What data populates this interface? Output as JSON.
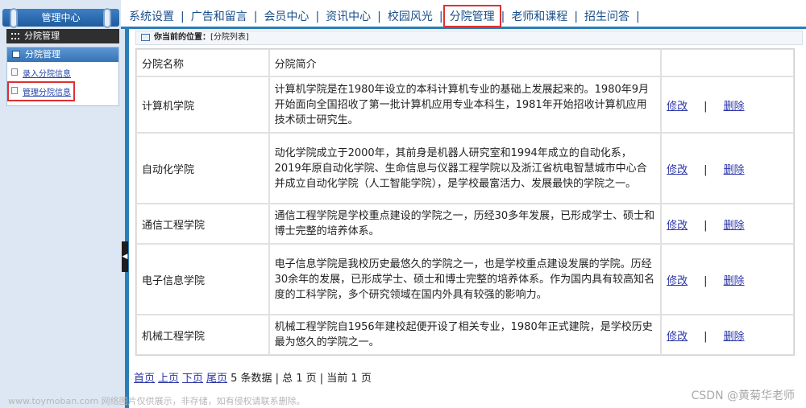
{
  "nav": {
    "items": [
      "系统设置",
      "广告和留言",
      "会员中心",
      "资讯中心",
      "校园风光",
      "分院管理",
      "老师和课程",
      "招生问答"
    ],
    "active_index": 5,
    "separator": "|"
  },
  "sidebar": {
    "title": "管理中心",
    "section_bar": "分院管理",
    "group_title": "分院管理",
    "links": [
      "录入分院信息",
      "管理分院信息"
    ],
    "active_link_index": 1
  },
  "splitter": {
    "toggle_glyph": "◀"
  },
  "location": {
    "label": "你当前的位置：",
    "value": "[分院列表]"
  },
  "table": {
    "headers": [
      "分院名称",
      "分院简介",
      ""
    ],
    "edit_label": "修改",
    "delete_label": "删除",
    "op_separator": "|",
    "rows": [
      {
        "name": "计算机学院",
        "desc": "计算机学院是在1980年设立的本科计算机专业的基础上发展起来的。1980年9月开始面向全国招收了第一批计算机应用专业本科生，1981年开始招收计算机应用技术硕士研究生。"
      },
      {
        "name": "自动化学院",
        "desc": "动化学院成立于2000年，其前身是机器人研究室和1994年成立的自动化系，2019年原自动化学院、生命信息与仪器工程学院以及浙江省杭电智慧城市中心合并成立自动化学院（人工智能学院），是学校最富活力、发展最快的学院之一。"
      },
      {
        "name": "通信工程学院",
        "desc": "通信工程学院是学校重点建设的学院之一，历经30多年发展，已形成学士、硕士和博士完整的培养体系。"
      },
      {
        "name": "电子信息学院",
        "desc": "电子信息学院是我校历史最悠久的学院之一，也是学校重点建设发展的学院。历经30余年的发展，已形成学士、硕士和博士完整的培养体系。作为国内具有较高知名度的工科学院，多个研究领域在国内外具有较强的影响力。"
      },
      {
        "name": "机械工程学院",
        "desc": "机械工程学院自1956年建校起便开设了相关专业，1980年正式建院，是学校历史最为悠久的学院之一。"
      }
    ]
  },
  "pager": {
    "first": "首页",
    "prev": "上页",
    "next": "下页",
    "last": "尾页",
    "summary": "5 条数据 | 总 1 页 | 当前 1 页"
  },
  "watermark": {
    "left": "www.toymoban.com 网络图片仅供展示，非存储，如有侵权请联系删除。",
    "right": "CSDN @黄菊华老师"
  }
}
